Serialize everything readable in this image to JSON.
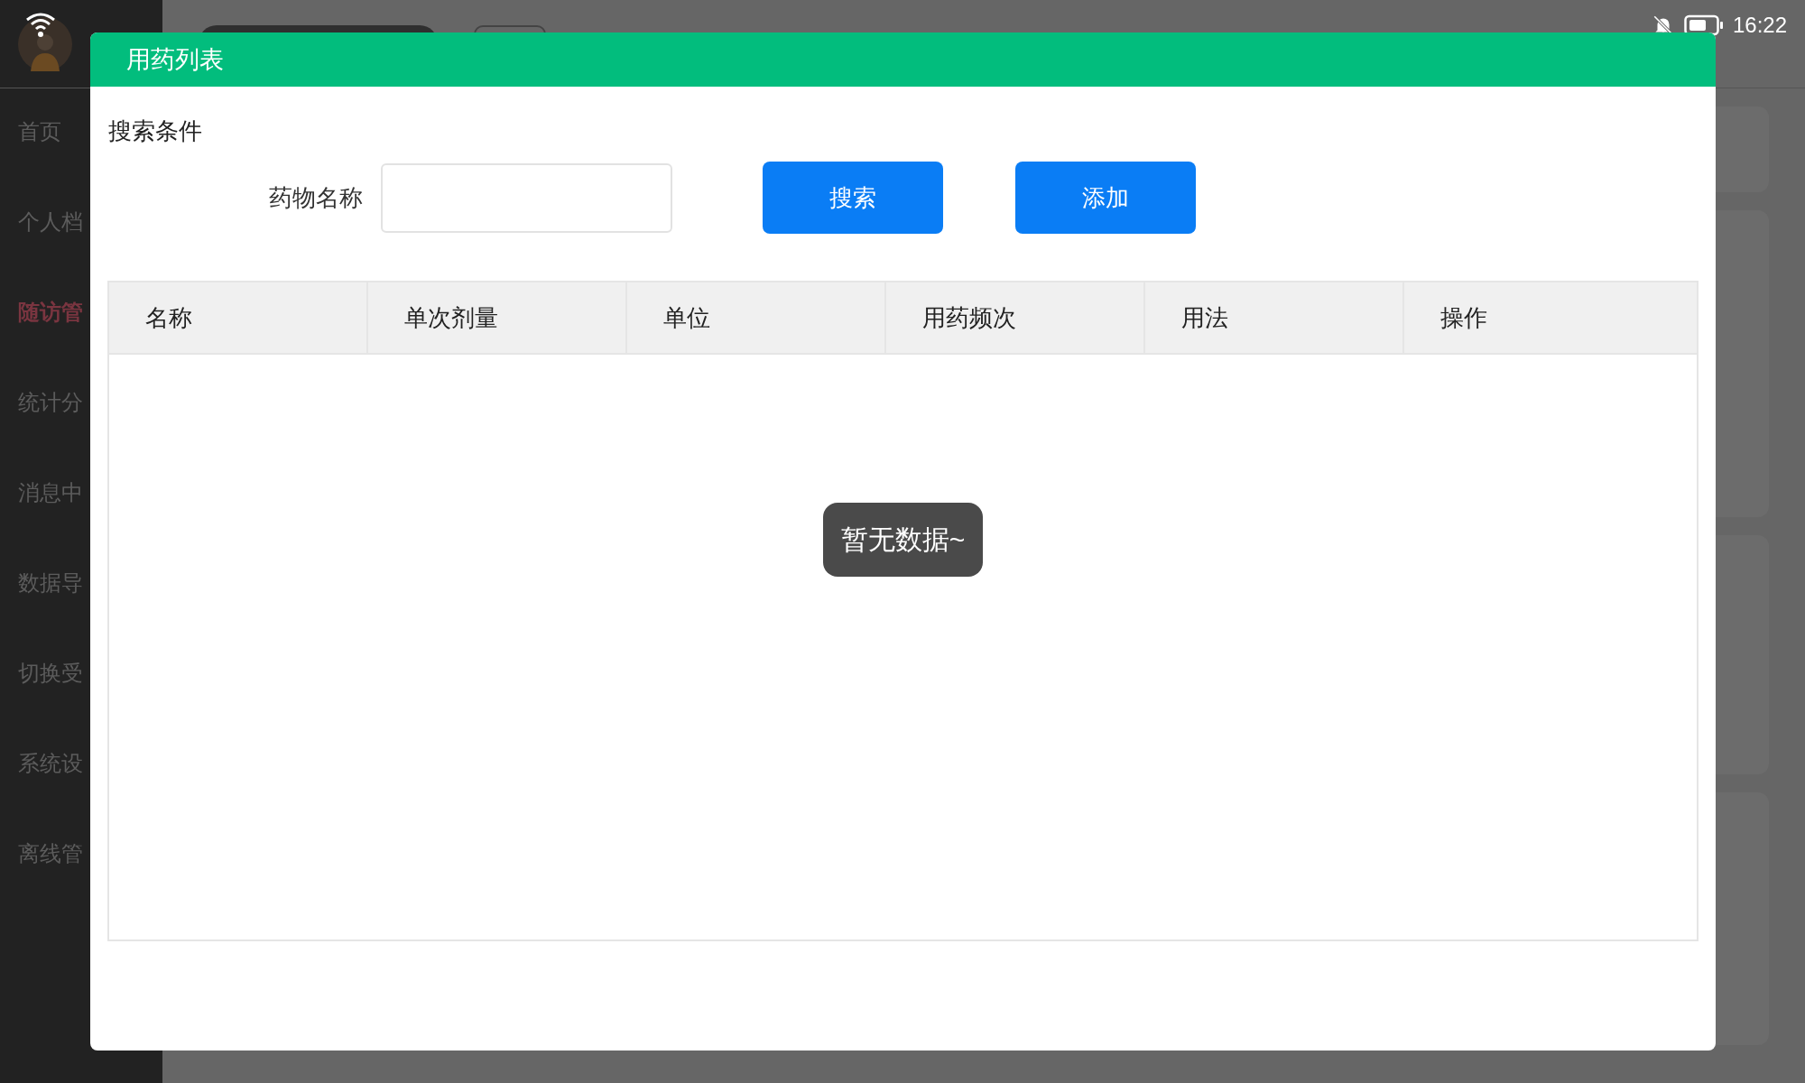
{
  "status_bar": {
    "time": "16:22"
  },
  "sidebar": {
    "items": [
      {
        "label": "首页",
        "selected": false
      },
      {
        "label": "个人档",
        "selected": false
      },
      {
        "label": "随访管",
        "selected": true
      },
      {
        "label": "统计分",
        "selected": false
      },
      {
        "label": "消息中",
        "selected": false
      },
      {
        "label": "数据导",
        "selected": false
      },
      {
        "label": "切换受",
        "selected": false
      },
      {
        "label": "系统设",
        "selected": false
      },
      {
        "label": "离线管",
        "selected": false
      }
    ]
  },
  "dialog": {
    "title": "用药列表",
    "search_title": "搜索条件",
    "field": {
      "label": "药物名称"
    },
    "buttons": [
      "搜索",
      "添加"
    ],
    "table": {
      "columns": [
        "名称",
        "单次剂量",
        "单位",
        "用药频次",
        "用法",
        "操作"
      ],
      "empty_message": "暂无数据~"
    }
  }
}
